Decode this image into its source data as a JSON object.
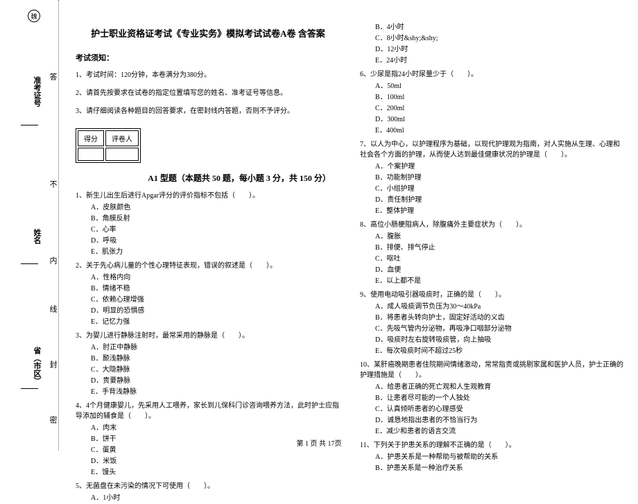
{
  "binding": {
    "mark_top": "魏",
    "mark_seal": "封",
    "mark_line": "线",
    "mark_inner": "内",
    "mark_no": "不",
    "mark_ans": "答",
    "mark_mi": "密",
    "field_ticket": "准考证号",
    "field_name": "姓名",
    "field_province": "省（市区）"
  },
  "title": "护士职业资格证考试《专业实务》模拟考试试卷A卷  含答案",
  "notice_head": "考试须知：",
  "notices": [
    "1、考试时间：120分钟，本卷满分为380分。",
    "2、请首先按要求在试卷的指定位置填写您的姓名、准考证号等信息。",
    "3、请仔细阅读各种题目的回答要求，在密封线内答题，否则不予评分。"
  ],
  "score_labels": {
    "score": "得分",
    "reviewer": "评卷人"
  },
  "section_title": "A1 型题（本题共 50 题，每小题 3 分，共 150 分）",
  "questions_left": [
    {
      "stem": "1、新生儿出生后进行Apgar评分的评价指标不包括（　　）。",
      "opts": [
        "A．皮肤颜色",
        "B．角膜反射",
        "C．心率",
        "D．呼吸",
        "E．肌张力"
      ]
    },
    {
      "stem": "2、关于先心病儿童的个性心理特征表现，错误的叙述是（　　）。",
      "opts": [
        "A．性格内向",
        "B．情绪不稳",
        "C．依赖心理增强",
        "D．明显的恐惧感",
        "E．记忆力强"
      ]
    },
    {
      "stem": "3、为婴儿进行静脉注射时，最常采用的静脉是（　　）。",
      "opts": [
        "A．肘正中静脉",
        "B．颞浅静脉",
        "C．大隐静脉",
        "D．贵要静脉",
        "E．手背浅静脉"
      ]
    },
    {
      "stem": "4、4个月健康婴儿，先采用人工喂养，家长到儿保科门诊咨询喂养方法，此时护士应指导添加的辅食是（　　）。",
      "opts": [
        "A．肉末",
        "B．饼干",
        "C．蛋黄",
        "D．米饭",
        "E．馒头"
      ]
    },
    {
      "stem": "5、无菌盘在未污染的情况下可使用（　　）。",
      "opts": [
        "A．1小时"
      ]
    }
  ],
  "questions_right_pre": [
    "B．4小时",
    "C．8小时&shy;&shy;",
    "D．12小时",
    "E．24小时"
  ],
  "questions_right": [
    {
      "stem": "6、少尿是指24小时尿量少于（　　）。",
      "opts": [
        "A．50ml",
        "B．100ml",
        "C．200ml",
        "D．300ml",
        "E．400ml"
      ]
    },
    {
      "stem": "7、以人为中心，以护理程序为基础，以现代护理观为指南，对人实施从生理、心理和社会各个方面的护理，从而使人达到最佳健康状况的护理是（　　）。",
      "opts": [
        "A．个案护理",
        "B．功能制护理",
        "C．小组护理",
        "D．责任制护理",
        "E．整体护理"
      ]
    },
    {
      "stem": "8、高位小肠梗阻病人，除腹痛外主要症状为（　　）。",
      "opts": [
        "A．腹胀",
        "B．排便、排气停止",
        "C．呕吐",
        "D．血便",
        "E．以上都不是"
      ]
    },
    {
      "stem": "9、使用电动吸引器吸痰时，正确的是（　　）。",
      "opts": [
        "A．成人吸痰调节负压为30～40kPa",
        "B．将患者头转向护士，固定好活动的义齿",
        "C．先吸气管内分泌物，再吸净口咽部分泌物",
        "D．吸痰时左右旋转吸痰管，向上抽吸",
        "E．每次吸痰时间不超过25秒"
      ]
    },
    {
      "stem": "10、某肝癌晚期患者住院期间情绪激动，常常指责或挑剔家属和医护人员，护士正确的护理措施是（　　）。",
      "opts": [
        "A．给患者正确的死亡观和人生观教育",
        "B．让患者尽可能的一个人独处",
        "C．认真倾听患者的心理感受",
        "D．诚恳地指出患者的不恰当行为",
        "E．减少和患者的语言交流"
      ]
    },
    {
      "stem": "11、下列关于护患关系的理解不正确的是（　　）。",
      "opts": [
        "A．护患关系是一种帮助与被帮助的关系",
        "B．护患关系是一种治疗关系"
      ]
    }
  ],
  "footer": "第 1 页 共 17页"
}
